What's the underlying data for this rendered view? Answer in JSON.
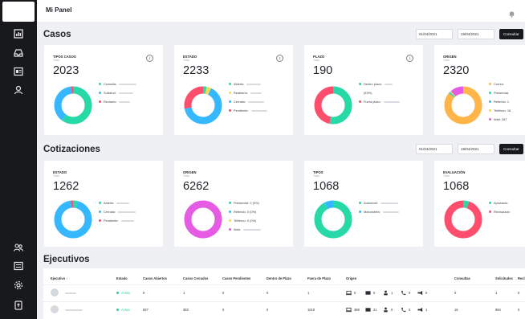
{
  "app": {
    "title": "Mi Panel"
  },
  "sidebar": {
    "icons": [
      "chart-icon",
      "inbox-icon",
      "layout-icon",
      "user-icon",
      "users-icon",
      "list-icon",
      "settings-icon",
      "export-icon"
    ]
  },
  "casos": {
    "title": "Casos",
    "date_from": "01/04/2021",
    "date_to": "19/04/2021",
    "button": "Consultar",
    "cards": [
      {
        "title": "TIPOS CASOS",
        "sub": "Total",
        "total": "2023",
        "legend": [
          "Consulta:",
          "Solicitud:",
          "Reclamo:"
        ]
      },
      {
        "title": "ESTADO",
        "sub": "Total",
        "total": "2233",
        "legend": [
          "Abierto:",
          "Reabierto:",
          "Cerrado:",
          "Pendiente:"
        ]
      },
      {
        "title": "PLAZO",
        "sub": "Total",
        "total": "190",
        "legend": [
          "Dentro plazo:",
          "(53%)",
          "Fuera plazo:"
        ]
      },
      {
        "title": "ORIGEN",
        "sub": "Total",
        "total": "2320",
        "legend": [
          "Correo:",
          "Presencial:",
          "Referido: 1",
          "Teléfono: 18",
          "Web: 287"
        ]
      }
    ]
  },
  "cotizaciones": {
    "title": "Cotizaciones",
    "date_from": "01/04/2021",
    "date_to": "19/04/2021",
    "button": "Consultar",
    "cards": [
      {
        "title": "ESTADO",
        "sub": "Total",
        "total": "1262",
        "legend": [
          "Abierto:",
          "Cerrado:",
          "Pendiente:"
        ]
      },
      {
        "title": "ORIGEN",
        "sub": "Total",
        "total": "6262",
        "legend": [
          "Presencial: 0 (0%)",
          "Referido: 0 (0%)",
          "Teléfono: 0 (0%)",
          "Web:"
        ]
      },
      {
        "title": "TIPOS",
        "sub": "Total",
        "total": "1068",
        "legend": [
          "Automóvil:",
          "Motocicleta:"
        ]
      },
      {
        "title": "EVALUACIÓN",
        "sub": "Total",
        "total": "1068",
        "legend": [
          "Aprobado:",
          "Rechazado:"
        ]
      }
    ]
  },
  "ejecutivos": {
    "title": "Ejecutivos",
    "headers": [
      "Ejecutivo ↑",
      "Estado",
      "Casos Abiertos",
      "Casos Cerrados",
      "Casos Pendientes",
      "Dentro de Plazo",
      "Fuera de Plazo",
      "Origen",
      "Consultas",
      "Solicitudes",
      "Recl"
    ],
    "rows": [
      {
        "estado": "Activo",
        "abiertos": "0",
        "cerrados": "1",
        "pendientes": "0",
        "dentro": "0",
        "fuera": "1",
        "origen": [
          "0",
          "0",
          "1",
          "0",
          "0"
        ],
        "consultas": "0",
        "solicitudes": "1",
        "recl": "0"
      },
      {
        "estado": "Activo",
        "abiertos": "827",
        "cerrados": "383",
        "pendientes": "0",
        "dentro": "0",
        "fuera": "1010",
        "origen": [
          "388",
          "21",
          "0",
          "0",
          "1"
        ],
        "consultas": "16",
        "solicitudes": "994",
        "recl": "0"
      }
    ]
  },
  "chart_colors": {
    "green": "#26d9a6",
    "blue": "#35b8ff",
    "red": "#ff4d6d",
    "yellow": "#f7d94c",
    "orange": "#ffb547",
    "pink": "#e55be3"
  },
  "chart_data": [
    {
      "type": "pie",
      "title": "TIPOS CASOS",
      "categories": [
        "Consulta",
        "Solicitud",
        "Reclamo"
      ],
      "values": [
        0.6,
        0.38,
        0.02
      ]
    },
    {
      "type": "pie",
      "title": "ESTADO",
      "categories": [
        "Abierto",
        "Reabierto",
        "Cerrado",
        "Pendiente"
      ],
      "values": [
        0.03,
        0.04,
        0.65,
        0.28
      ]
    },
    {
      "type": "pie",
      "title": "PLAZO",
      "categories": [
        "Dentro plazo",
        "Fuera plazo"
      ],
      "values": [
        0.53,
        0.47
      ]
    },
    {
      "type": "pie",
      "title": "ORIGEN",
      "categories": [
        "Correo",
        "Presencial",
        "Referido",
        "Teléfono",
        "Web"
      ],
      "values": [
        0.86,
        0.01,
        0.005,
        0.01,
        0.115
      ]
    },
    {
      "type": "pie",
      "title": "ESTADO",
      "categories": [
        "Abierto",
        "Cerrado",
        "Pendiente"
      ],
      "values": [
        0.04,
        0.94,
        0.02
      ]
    },
    {
      "type": "pie",
      "title": "ORIGEN",
      "categories": [
        "Presencial",
        "Referido",
        "Teléfono",
        "Web"
      ],
      "values": [
        0.0,
        0.0,
        0.0,
        1.0
      ]
    },
    {
      "type": "pie",
      "title": "TIPOS",
      "categories": [
        "Automóvil",
        "Motocicleta"
      ],
      "values": [
        0.92,
        0.08
      ]
    },
    {
      "type": "pie",
      "title": "EVALUACIÓN",
      "categories": [
        "Aprobado",
        "Rechazado"
      ],
      "values": [
        0.05,
        0.95
      ]
    }
  ]
}
